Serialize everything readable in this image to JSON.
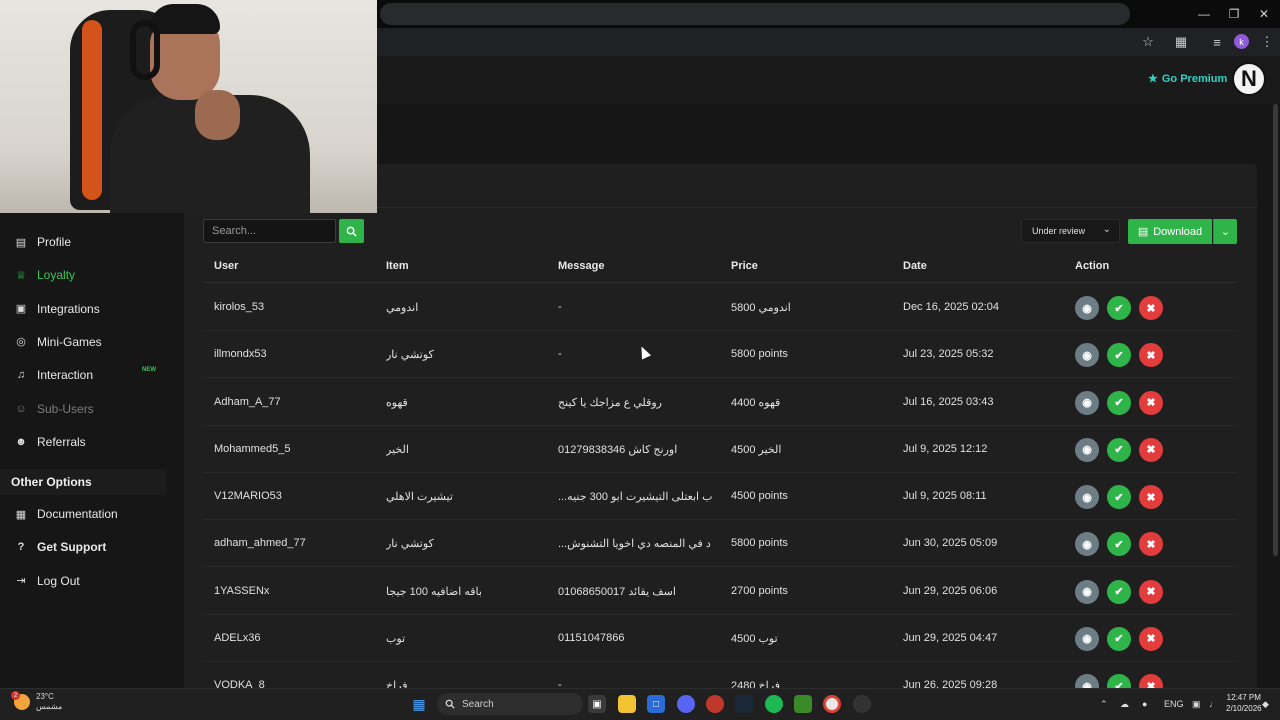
{
  "header": {
    "premium_label": "Go Premium",
    "logo_letter": "N"
  },
  "browser": {
    "profile_initial": "k"
  },
  "sidebar": {
    "items": [
      {
        "label": "Profile",
        "icon": "profile-card-icon"
      },
      {
        "label": "Loyalty",
        "icon": "trophy-icon"
      },
      {
        "label": "Integrations",
        "icon": "integrations-icon"
      },
      {
        "label": "Mini-Games",
        "icon": "gamepad-icon"
      },
      {
        "label": "Interaction",
        "icon": "music-note-icon"
      },
      {
        "label": "Sub-Users",
        "icon": "sub-users-icon"
      },
      {
        "label": "Referrals",
        "icon": "referrals-icon"
      }
    ],
    "new_badge": "NEW",
    "section_title": "Other Options",
    "other_items": [
      {
        "label": "Documentation",
        "icon": "book-icon"
      },
      {
        "label": "Get Support",
        "icon": "help-circle-icon"
      },
      {
        "label": "Log Out",
        "icon": "logout-icon"
      }
    ]
  },
  "toolbar": {
    "search_placeholder": "Search...",
    "status_filter": "Under review",
    "download_label": "Download"
  },
  "table": {
    "columns": [
      "User",
      "Item",
      "Message",
      "Price",
      "Date",
      "Action"
    ],
    "rows": [
      {
        "user": "kirolos_53",
        "item": "اندومي",
        "message": "-",
        "price": "اندومي 5800",
        "date": "Dec 16, 2025 02:04"
      },
      {
        "user": "illmondx53",
        "item": "كوتشي نار",
        "message": "-",
        "price": "5800 points",
        "date": "Jul 23, 2025 05:32"
      },
      {
        "user": "Adham_A_77",
        "item": "قهوه",
        "message": "روقلي ع مزاجك يا كينج",
        "price": "قهوه 4400",
        "date": "Jul 16, 2025 03:43"
      },
      {
        "user": "Mohammed5_5",
        "item": "الخير",
        "message": "01279838346 اورنج كاش",
        "price": "الخير 4500",
        "date": "Jul 9, 2025 12:12"
      },
      {
        "user": "V12MARIO53",
        "item": "تيشيرت الاهلي",
        "message": "...ب ابعتلى التيشيرت ابو 300 جنيه",
        "price": "4500 points",
        "date": "Jul 9, 2025 08:11"
      },
      {
        "user": "adham_ahmed_77",
        "item": "كوتشي نار",
        "message": "...د في المنصه دي اخويا التشنوش",
        "price": "5800 points",
        "date": "Jun 30, 2025 05:09"
      },
      {
        "user": "1YASSENx",
        "item": "باقه اضافيه 100 جيجا",
        "message": "01068650017 اسف يقائد",
        "price": "2700 points",
        "date": "Jun 29, 2025 06:06"
      },
      {
        "user": "ADELx36",
        "item": "توب",
        "message": "01151047866",
        "price": "توب 4500",
        "date": "Jun 29, 2025 04:47"
      },
      {
        "user": "VODKA_8",
        "item": "فراخ",
        "message": "-",
        "price": "فراخ 2480",
        "date": "Jun 26, 2025 09:28"
      }
    ]
  },
  "taskbar": {
    "temperature": "23°C",
    "weather_text": "مشمس",
    "weather_badge": "2",
    "search_label": "Search",
    "language": "ENG",
    "time": "12:47 PM",
    "date": "2/10/2026"
  }
}
